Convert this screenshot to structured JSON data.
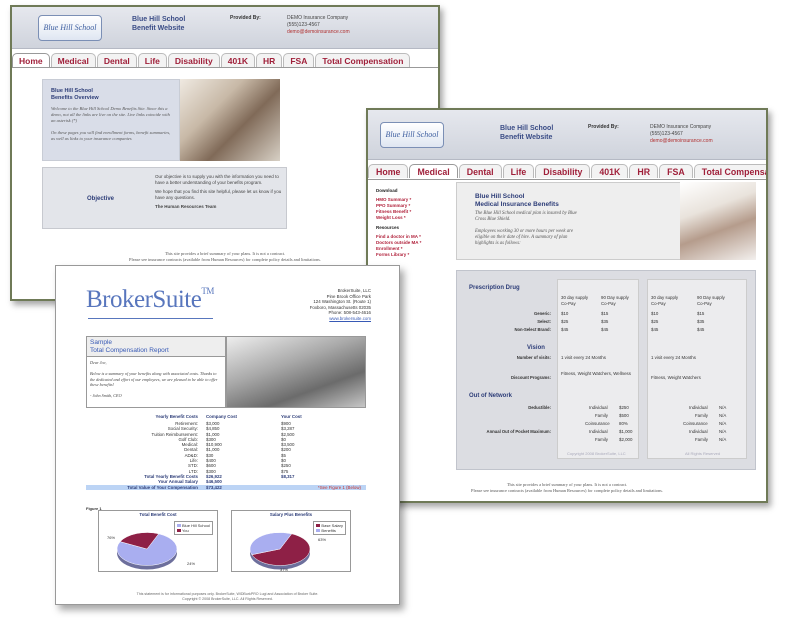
{
  "site": {
    "logo": "Blue Hill School",
    "title_line1": "Blue Hill School",
    "title_line2": "Benefit Website",
    "provided_by": "Provided By:",
    "company_line1": "DEMO Insurance Company",
    "company_line2": "(555)123-4567",
    "company_link": "demo@demoinsurance.com"
  },
  "tabs": [
    "Home",
    "Medical",
    "Dental",
    "Life",
    "Disability",
    "401K",
    "HR",
    "FSA",
    "Total Compensation"
  ],
  "home": {
    "overview_title": "Blue Hill School\nBenefits Overview",
    "overview_text": "Welcome to the Blue Hill School Demo Benefits Site. Since this a demo, not all the links are live on the site. Live links coincide with an asterisk (*)\n\nOn these pages you will find enrollment forms, benefit summaries, as well as links to your insurance companies",
    "objective_label": "Objective",
    "objective_text1": "Our objective is to supply you with the information you need to have a better understanding of your benefits program.",
    "objective_text2": "We hope that you find this site helpful, please let us know if you have any questions.",
    "objective_team": "The Human Resources Team",
    "disclaimer": "This site provides a brief summary of your plans. It is not a contract.\nPlease see insurance contracts (available from Human Resources) for complete policy details and limitations."
  },
  "medical": {
    "sidebar": {
      "download_heading": "Download",
      "download_links": [
        "HMO Summary *",
        "PPO Summary *",
        "Fitness Benefit *",
        "Weight Loss *"
      ],
      "resources_heading": "Resources",
      "resource_links": [
        "Find a doctor in MA *",
        "Doctors outside MA *",
        "Enrollment *",
        "Forms Library *"
      ]
    },
    "banner_title": "Blue Hill School\nMedical Insurance Benefits",
    "banner_text": "The Blue Hill School medical plan is insured by Blue Cross Blue Shield.\n\nEmployees working 30 or more hours per week are eligible on their date of hire. A summary of plan highlights is as follows:",
    "prescription_title": "Prescription Drug",
    "supply_headers": [
      "30 day supply\nCo-Pay",
      "90 Day supply\nCo-Pay",
      "30 day supply\nCo-Pay",
      "90 Day supply\nCo-Pay"
    ],
    "rx_rows": [
      {
        "label": "Generic:",
        "values": [
          "$10",
          "$15",
          "$10",
          "$15"
        ]
      },
      {
        "label": "Select:",
        "values": [
          "$25",
          "$35",
          "$25",
          "$35"
        ]
      },
      {
        "label": "Non-Select Brand:",
        "values": [
          "$45",
          "$45",
          "$45",
          "$45"
        ]
      }
    ],
    "vision_title": "Vision",
    "vision_rows": [
      {
        "label": "Number of visits:",
        "values": [
          "1 visit every 24 Months",
          "1 visit every 24 Months"
        ]
      },
      {
        "label": "Discount Programs:",
        "values": [
          "Fitness, Weight Watchers, Wellness",
          "Fitness, Weight Watchers"
        ]
      }
    ],
    "oon_title": "Out of Network",
    "oon_rows": [
      {
        "label": "Deductible:",
        "values": [
          [
            "Individual",
            "$250"
          ],
          [
            "Family",
            "$500"
          ]
        ],
        "right": [
          [
            "Individual",
            "N/A"
          ],
          [
            "Family",
            "N/A"
          ]
        ]
      },
      {
        "label": "",
        "values": [
          [
            "Coinsurance",
            "80%"
          ]
        ],
        "right": [
          [
            "Coinsurance",
            "N/A"
          ]
        ]
      },
      {
        "label": "Annual Out of Pocket Maximum:",
        "values": [
          [
            "Individual",
            "$1,000"
          ],
          [
            "Family",
            "$2,000"
          ]
        ],
        "right": [
          [
            "Individual",
            "N/A"
          ],
          [
            "Family",
            "N/A"
          ]
        ]
      }
    ],
    "copyright_left": "Copyright 2008 BrokerSuite, LLC",
    "copyright_right": "All Rights Reserved",
    "disclaimer": "This site provides a brief summary of your plans. It is not a contract.\nPlease see insurance contracts (available from Human Resources) for complete policy details and limitations."
  },
  "broker": {
    "logo": "BrokerSuite",
    "tm": "TM",
    "address_lines": [
      "BrokerSuite, LLC",
      "Pine Brook Office Park",
      "124 Washington St. (Route 1)",
      "Foxboro, Massachusetts 02035",
      "Phone: 508-543-4616"
    ],
    "address_link": "www.brokersuite.com",
    "report_title": "Sample\nTotal Compensation Report",
    "report_body": "Dear Joe,\n\nBelow is a summary of your benefits along with associated costs. Thanks to the dedicated and effort of our employees, we are pleased to be able to offer these benefits!\n\n- John Smith, CEO",
    "cost_headers": [
      "Yearly Benefit Costs",
      "Company Cost",
      "Your Cost"
    ],
    "cost_rows": [
      {
        "label": "Retirement:",
        "company": "$3,000",
        "yours": "$900"
      },
      {
        "label": "Social Security:",
        "company": "$4,850",
        "yours": "$3,287"
      },
      {
        "label": "Tuition Reimbursement:",
        "company": "$1,000",
        "yours": "$2,500"
      },
      {
        "label": "Golf Club:",
        "company": "$300",
        "yours": "$0"
      },
      {
        "label": "Medical:",
        "company": "$10,900",
        "yours": "$3,500"
      },
      {
        "label": "Dental:",
        "company": "$1,000",
        "yours": "$200"
      },
      {
        "label": "AD&D:",
        "company": "$30",
        "yours": "$5"
      },
      {
        "label": "Life:",
        "company": "$400",
        "yours": "$0"
      },
      {
        "label": "STD:",
        "company": "$600",
        "yours": "$250"
      },
      {
        "label": "LTD:",
        "company": "$300",
        "yours": "$75"
      }
    ],
    "total_rows": [
      {
        "label": "Total Yearly Benefit Costs",
        "company": "$26,922",
        "yours": "$8,317"
      },
      {
        "label": "Your Annual Salary",
        "company": "$46,500",
        "yours": ""
      }
    ],
    "grand_total": {
      "label": "Total Value of Your Compensation",
      "company": "$73,422",
      "note": "*See Figure 1 (Below)"
    },
    "figure_label": "Figure 1",
    "footer": "This statement is for informational purposes only. BrokerSuite, WIDBurkPRO Lugi and Association of Broker Suite.\nCopyright © 2008 BrokerSuite, LLC. All Rights Reserved."
  },
  "chart_data": [
    {
      "type": "pie",
      "title": "Total Benefit Cost",
      "categories": [
        "Blue Hill School",
        "You"
      ],
      "values": [
        76,
        24
      ],
      "slice_labels": [
        "76%",
        "24%"
      ],
      "colors": [
        "#a9aef0",
        "#8e2046"
      ],
      "legend": "top-right"
    },
    {
      "type": "pie",
      "title": "Salary Plus Benefits",
      "categories": [
        "Base Salary",
        "Benefits"
      ],
      "values": [
        63,
        37
      ],
      "slice_labels": [
        "63%",
        "37%"
      ],
      "colors": [
        "#8e2046",
        "#a9aef0"
      ],
      "legend": "top-right"
    }
  ]
}
